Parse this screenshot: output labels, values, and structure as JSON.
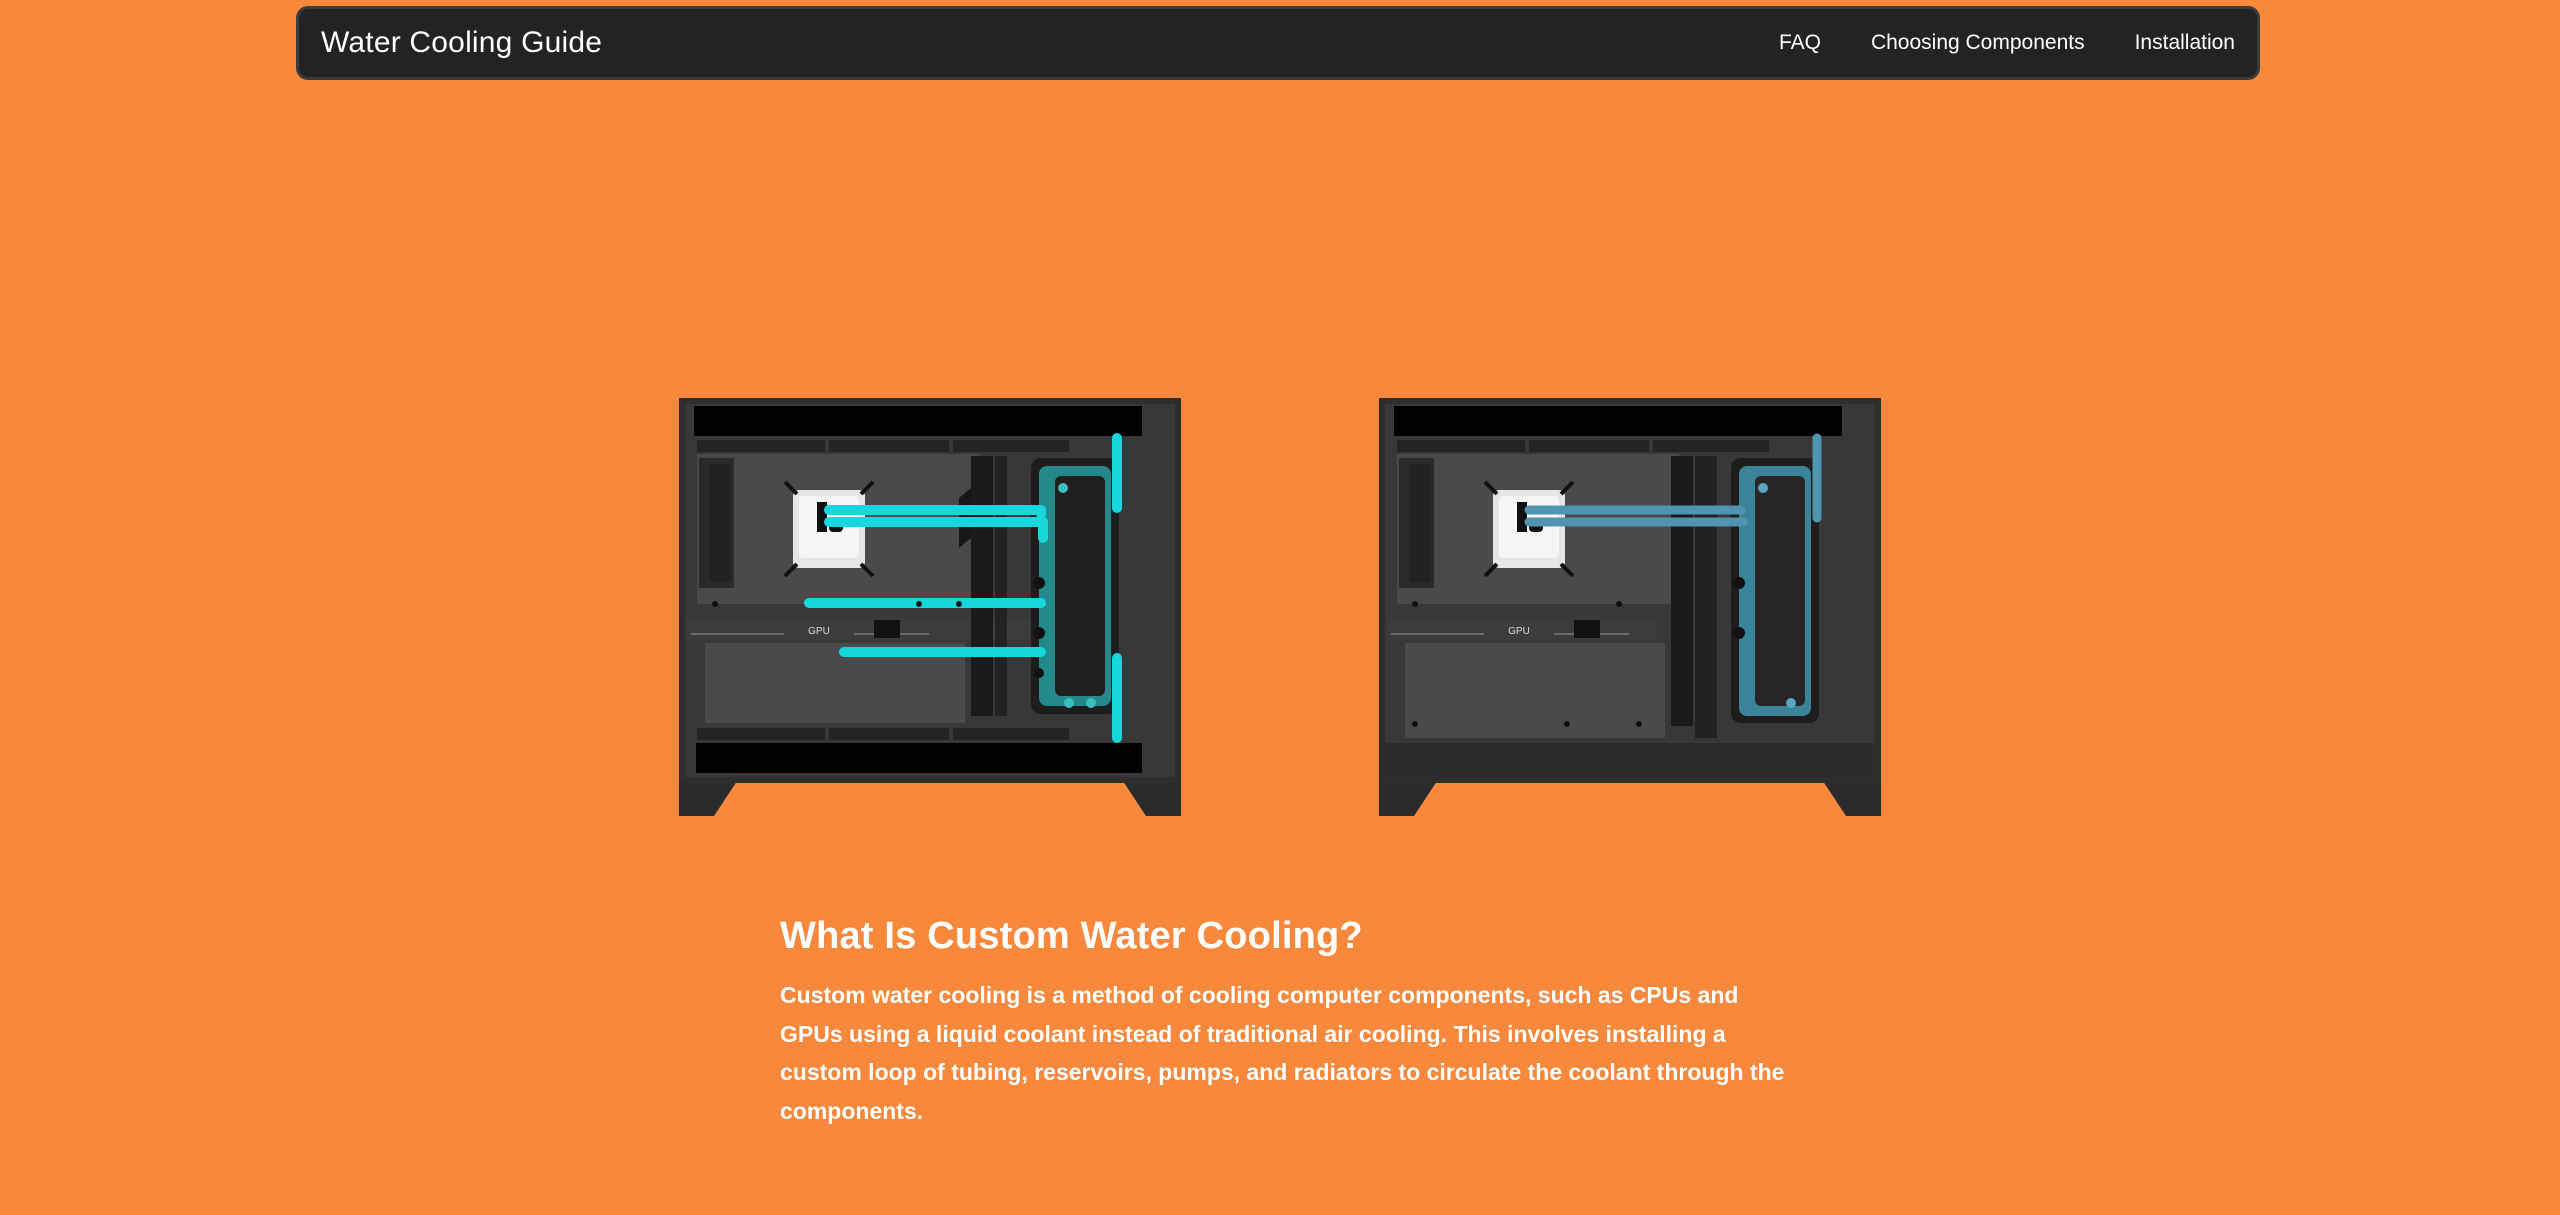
{
  "nav": {
    "brand": "Water Cooling Guide",
    "links": [
      "FAQ",
      "Choosing Components",
      "Installation"
    ]
  },
  "images": {
    "gpu_label": "GPU",
    "tube_colors": {
      "bright": "#16d8dc",
      "muted": "#3f8fa6"
    }
  },
  "article": {
    "heading": "What Is Custom Water Cooling?",
    "body": "Custom water cooling is a method of cooling computer components, such as CPUs and GPUs using a liquid coolant instead of traditional air cooling. This involves installing a custom loop of tubing, reservoirs, pumps, and radiators to circulate the coolant through the components."
  },
  "colors": {
    "background": "#f8883c",
    "navbar": "#232323",
    "text": "#ffffff"
  }
}
